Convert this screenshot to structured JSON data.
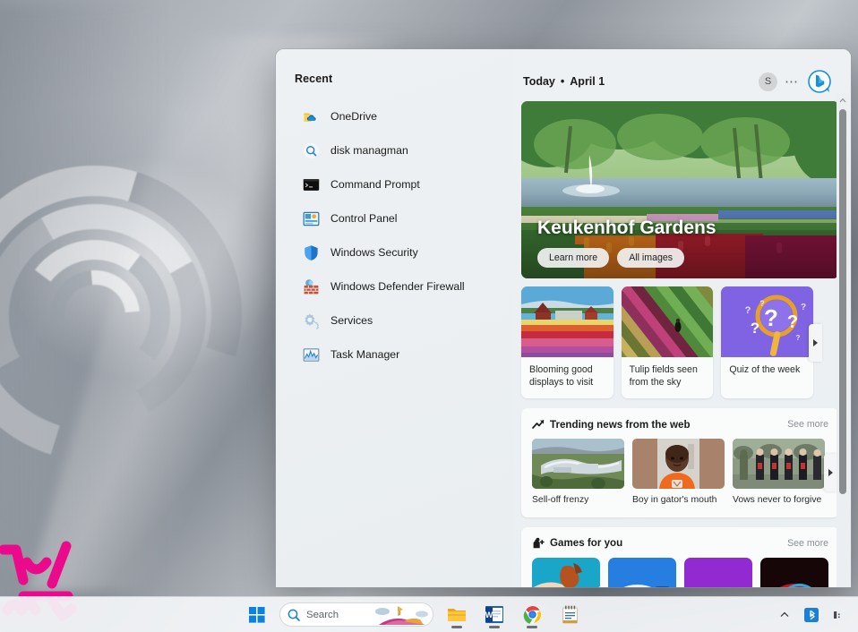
{
  "desktop": {
    "watermark": "pink-stick-figure-logo"
  },
  "panel": {
    "recent": {
      "title": "Recent",
      "items": [
        {
          "label": "OneDrive",
          "icon": "onedrive-icon"
        },
        {
          "label": "disk managman",
          "icon": "search-history-icon"
        },
        {
          "label": "Command Prompt",
          "icon": "command-prompt-icon"
        },
        {
          "label": "Control Panel",
          "icon": "control-panel-icon"
        },
        {
          "label": "Windows Security",
          "icon": "shield-icon"
        },
        {
          "label": "Windows Defender Firewall",
          "icon": "firewall-icon"
        },
        {
          "label": "Services",
          "icon": "services-gear-icon"
        },
        {
          "label": "Task Manager",
          "icon": "task-manager-icon"
        }
      ]
    },
    "feed": {
      "today_label": "Today",
      "separator": "•",
      "date": "April 1",
      "account_initial": "S",
      "more_label": "⋯",
      "bing_icon": "bing-chat-icon",
      "hero": {
        "title": "Keukenhof Gardens",
        "learn_more": "Learn more",
        "all_images": "All images"
      },
      "cards": [
        {
          "caption": "Blooming good displays to visit",
          "image": "tulip-field-farm-photo"
        },
        {
          "caption": "Tulip fields seen from the sky",
          "image": "aerial-tulip-rows-photo"
        },
        {
          "caption": "Quiz of the week",
          "image": "purple-question-marks-graphic"
        }
      ],
      "trending": {
        "title": "Trending news from the web",
        "icon": "trending-arrow-icon",
        "see_more": "See more",
        "items": [
          {
            "caption": "Sell-off frenzy",
            "image": "hillside-mansion-photo"
          },
          {
            "caption": "Boy in gator's mouth",
            "image": "boy-orange-shirt-photo"
          },
          {
            "caption": "Vows never to forgive",
            "image": "memorial-procession-photo"
          }
        ]
      },
      "games": {
        "title": "Games for you",
        "icon": "game-piece-icon",
        "see_more": "See more",
        "items": [
          {
            "image": "teal-horse-game-tile"
          },
          {
            "image": "blue-game-tile"
          },
          {
            "image": "purple-game-tile"
          },
          {
            "image": "red-game-tile"
          }
        ]
      }
    }
  },
  "taskbar": {
    "start_label": "Start",
    "search": {
      "placeholder": "Search",
      "value": "",
      "icon": "search-icon"
    },
    "apps": [
      {
        "name": "file-explorer",
        "label": "File Explorer"
      },
      {
        "name": "word",
        "label": "Word"
      },
      {
        "name": "chrome",
        "label": "Google Chrome"
      },
      {
        "name": "notepad",
        "label": "Notepad"
      }
    ],
    "tray": {
      "overflow": "^",
      "bluetooth": "bluetooth-icon",
      "network": "network-icon"
    }
  },
  "colors": {
    "accent": "#0078d4",
    "panel_bg": "#eef1f3",
    "card_bg": "#fafcfc",
    "taskbar_bg": "#f3f5f7",
    "text": "#1b1b1b",
    "muted": "#8a8f94",
    "watermark": "#ec0a8c"
  }
}
